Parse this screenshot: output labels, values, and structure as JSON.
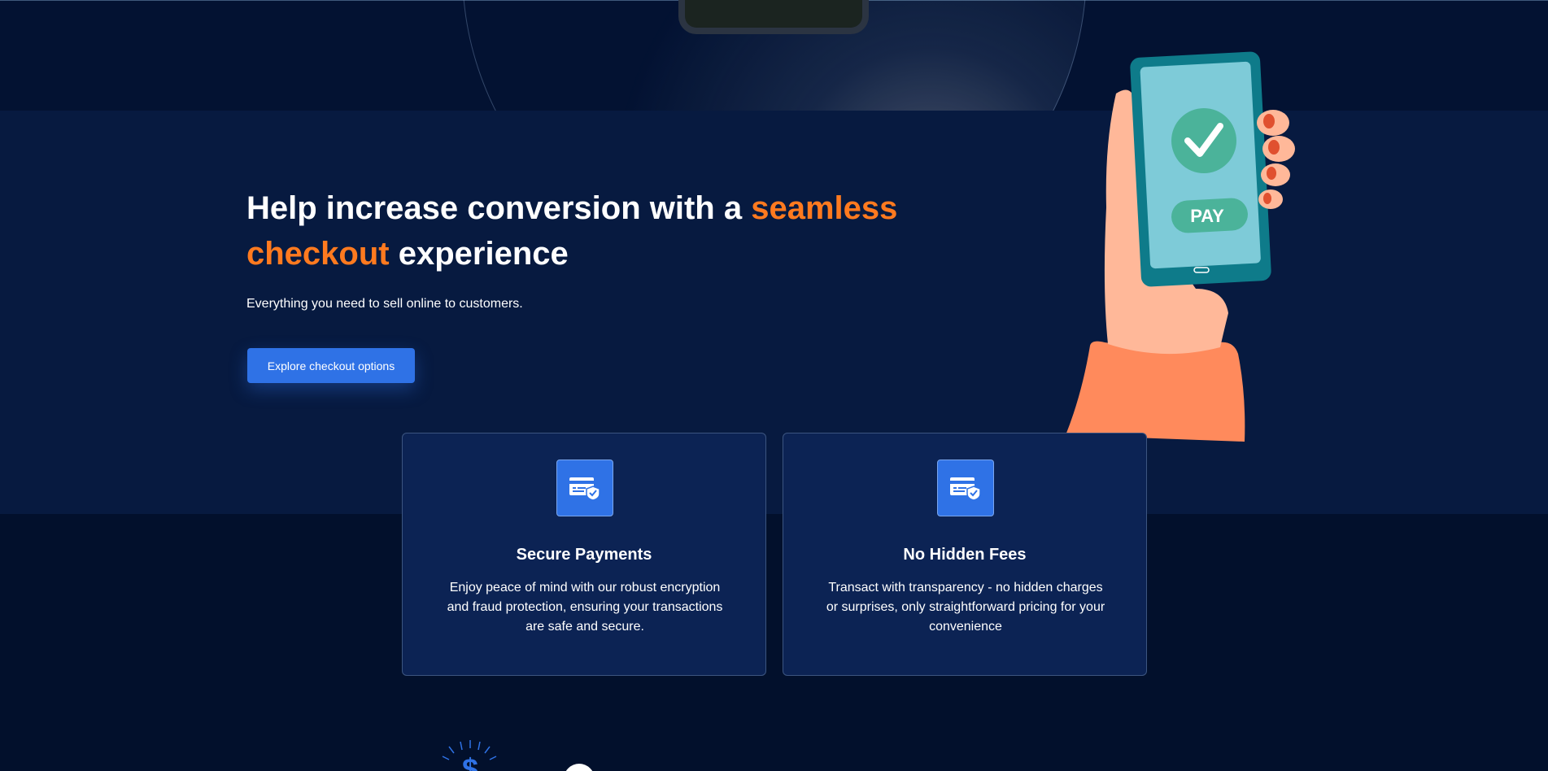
{
  "hero": {
    "title_part1": "Help increase conversion with a ",
    "title_accent": "seamless checkout",
    "title_part2": " experience",
    "subtitle": "Everything you need to sell online to customers.",
    "cta_label": "Explore checkout options"
  },
  "illustration": {
    "phone_button_label": "PAY",
    "icon": "hand-holding-phone-checkmark"
  },
  "features": [
    {
      "icon": "secure-card-icon",
      "title": "Secure Payments",
      "text": "Enjoy peace of mind with our robust encryption and fraud protection, ensuring your transactions are safe and secure."
    },
    {
      "icon": "secure-card-icon",
      "title": "No Hidden Fees",
      "text": "Transact with transparency - no hidden charges or surprises, only straightforward pricing for your convenience"
    }
  ],
  "colors": {
    "background": "#020f2b",
    "hero_band": "#071a40",
    "accent_orange": "#ff7a1f",
    "primary_blue": "#2f72e6",
    "card_background": "#0c2354"
  }
}
